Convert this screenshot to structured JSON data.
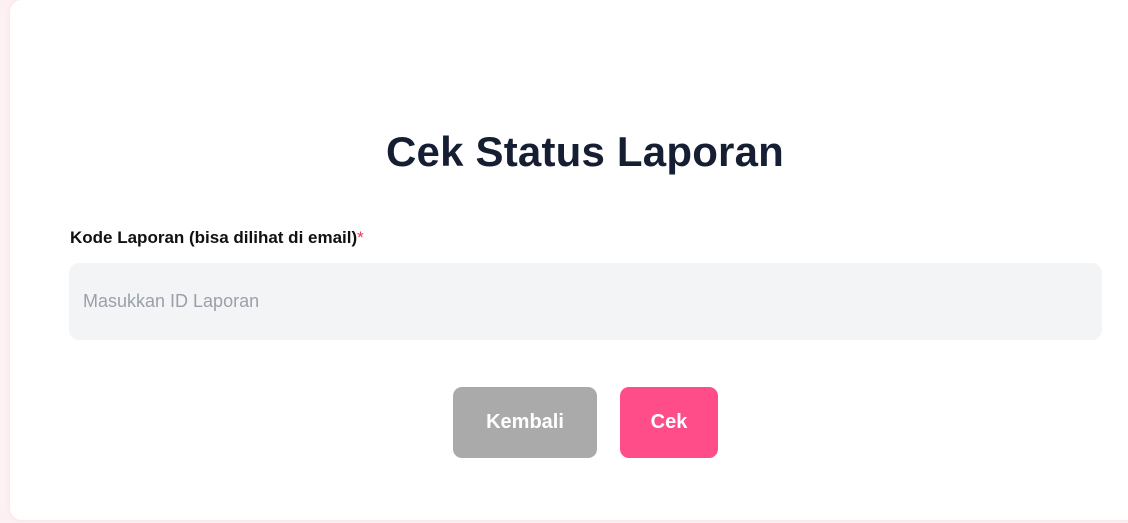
{
  "page": {
    "title": "Cek Status Laporan"
  },
  "form": {
    "report_code_label": "Kode Laporan (bisa dilihat di email)",
    "required_mark": "*",
    "report_code_placeholder": "Masukkan ID Laporan",
    "report_code_value": ""
  },
  "actions": {
    "back_label": "Kembali",
    "check_label": "Cek"
  },
  "colors": {
    "accent": "#ff4d8a",
    "secondary_button": "#aaaaaa",
    "required": "#e53955",
    "title": "#161e33",
    "input_background": "#f3f4f6"
  }
}
